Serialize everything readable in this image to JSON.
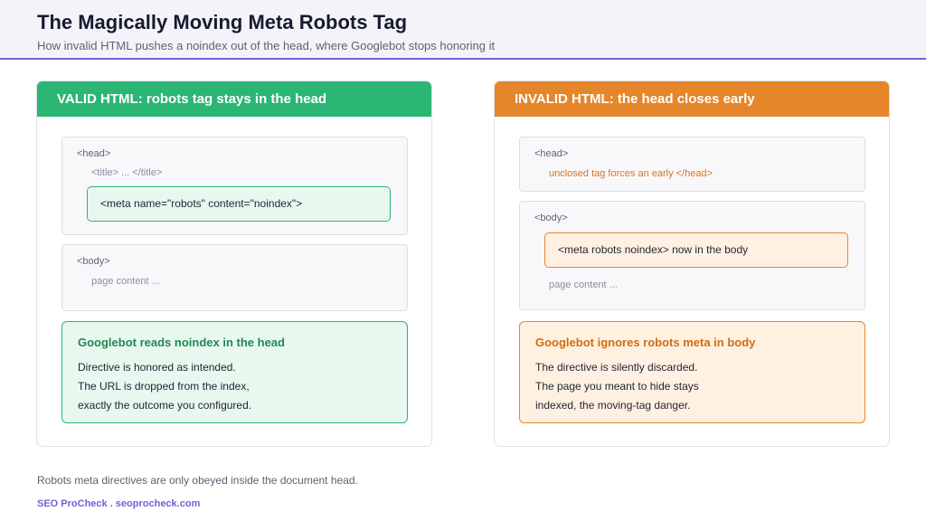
{
  "header": {
    "title": "The Magically Moving Meta Robots Tag",
    "subtitle": "How invalid HTML pushes a noindex out of the head, where Googlebot stops honoring it"
  },
  "valid_panel": {
    "title": "VALID HTML: robots tag stays in the head",
    "head_label": "<head>",
    "title_line": "<title> ... </title>",
    "meta_tag": "<meta name=\"robots\" content=\"noindex\">",
    "body_label": "<body>",
    "body_content": "page content ...",
    "result_title": "Googlebot reads noindex in the head",
    "result_lines": [
      "Directive is honored as intended.",
      "The URL is dropped from the index,",
      "exactly the outcome you configured."
    ]
  },
  "invalid_panel": {
    "title": "INVALID HTML: the head closes early",
    "head_label": "<head>",
    "warning_line": "unclosed tag forces an early </head>",
    "body_label": "<body>",
    "meta_tag": "<meta robots noindex> now in the body",
    "body_content": "page content ...",
    "result_title": "Googlebot ignores robots meta in body",
    "result_lines": [
      "The directive is silently discarded.",
      "The page you meant to hide stays",
      "indexed, the moving-tag danger."
    ]
  },
  "footer": {
    "note": "Robots meta directives are only obeyed inside the document head.",
    "brand": "SEO ProCheck . seoprocheck.com"
  },
  "colors": {
    "accent": "#7b5cd6",
    "valid": "#2bb673",
    "invalid": "#e5862b"
  }
}
